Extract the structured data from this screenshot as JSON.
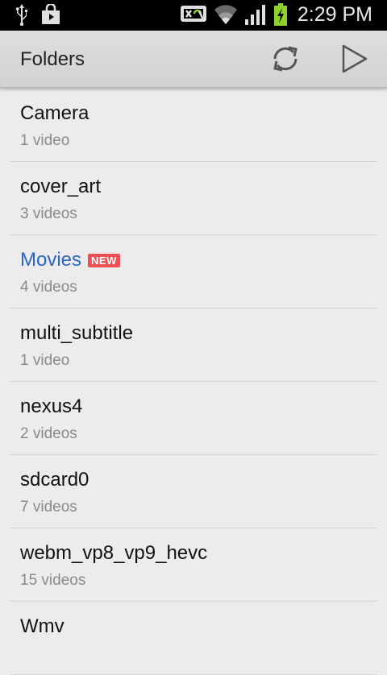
{
  "status_bar": {
    "time": "2:29 PM",
    "icons": [
      "usb-icon",
      "shopping-bag-icon",
      "wireless-display-icon",
      "wifi-icon",
      "signal-icon",
      "battery-charging-icon"
    ]
  },
  "action_bar": {
    "title": "Folders",
    "refresh_icon": "refresh-icon",
    "play_icon": "play-icon"
  },
  "colors": {
    "new_accent": "#2d65c8",
    "badge": "#ee4f55",
    "battery": "#8ed32a"
  },
  "folders": [
    {
      "name": "Camera",
      "count": "1 video",
      "is_new": false
    },
    {
      "name": "cover_art",
      "count": "3 videos",
      "is_new": false
    },
    {
      "name": "Movies",
      "count": "4 videos",
      "is_new": true,
      "badge": "NEW"
    },
    {
      "name": "multi_subtitle",
      "count": "1 video",
      "is_new": false
    },
    {
      "name": "nexus4",
      "count": "2 videos",
      "is_new": false
    },
    {
      "name": "sdcard0",
      "count": "7 videos",
      "is_new": false
    },
    {
      "name": "webm_vp8_vp9_hevc",
      "count": "15 videos",
      "is_new": false
    },
    {
      "name": "Wmv",
      "count": "",
      "is_new": false
    }
  ]
}
